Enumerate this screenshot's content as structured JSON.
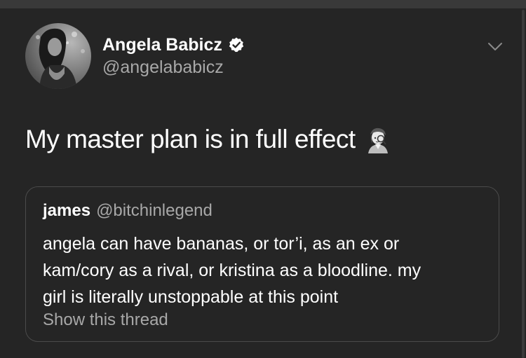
{
  "tweet": {
    "author": {
      "display_name": "Angela Babicz",
      "handle": "@angelababicz",
      "verified": true
    },
    "text": "My master plan is in full effect",
    "emoji": "woman-detective-emoji"
  },
  "quoted_tweet": {
    "author": {
      "display_name": "james",
      "handle": "@bitchinlegend"
    },
    "lines": [
      "angela can have bananas, or tor’i, as an ex or",
      "kam/cory as a rival, or kristina as a bloodline. my",
      "girl is literally unstoppable at this point"
    ],
    "show_thread_label": "Show this thread"
  },
  "icons": {
    "verified": "verified-badge-icon",
    "menu": "chevron-down-icon"
  },
  "colors": {
    "background": "#252525",
    "secondary_text": "#a8a8a8",
    "border": "#4b4b4b"
  }
}
